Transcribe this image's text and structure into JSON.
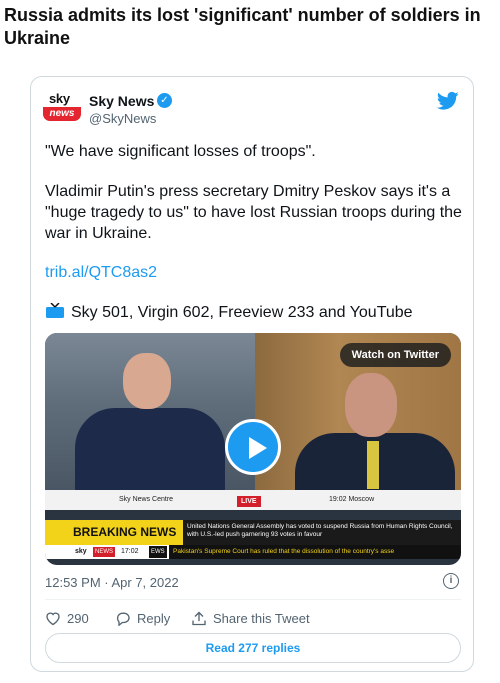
{
  "headline": "Russia admits its lost 'significant' number of soldiers in Ukraine",
  "tweet": {
    "author_name": "Sky News",
    "author_handle": "@SkyNews",
    "logo_top": "sky",
    "logo_bottom": "news",
    "line1": "\"We have significant losses of troops\".",
    "line2": "Vladimir Putin's press secretary Dmitry Peskov says it's a \"huge tragedy to us\" to have lost Russian troops during the war in Ukraine.",
    "link": "trib.al/QTC8as2",
    "channels": "Sky 501, Virgin 602, Freeview 233 and YouTube",
    "timestamp": "12:53 PM · Apr 7, 2022",
    "likes": "290",
    "reply_label": "Reply",
    "share_label": "Share this Tweet",
    "read_replies": "Read 277 replies"
  },
  "video": {
    "watch_label": "Watch on Twitter",
    "strap_left": "Sky News Centre",
    "strap_live": "LIVE",
    "strap_right": "19:02 Moscow",
    "breaking": "BREAKING NEWS",
    "ticker_top": "United Nations General Assembly has voted to suspend Russia from Human Rights Council, with U.S.-led push garnering 93 votes in favour",
    "bottom_sky": "sky",
    "bottom_news": "NEWS",
    "bottom_time": "17:02",
    "bottom_ews": "EWS",
    "bottom_ticker": "Pakistan's Supreme Court has ruled that the dissolution of the country's asse"
  },
  "colors": {
    "twitter_blue": "#1d9bf0",
    "sky_red": "#e3262f",
    "breaking_yellow": "#f3d31a"
  },
  "icons": [
    "verified-badge-icon",
    "twitter-bird-icon",
    "tv-icon",
    "play-icon",
    "info-icon",
    "heart-icon",
    "reply-icon",
    "share-icon"
  ]
}
